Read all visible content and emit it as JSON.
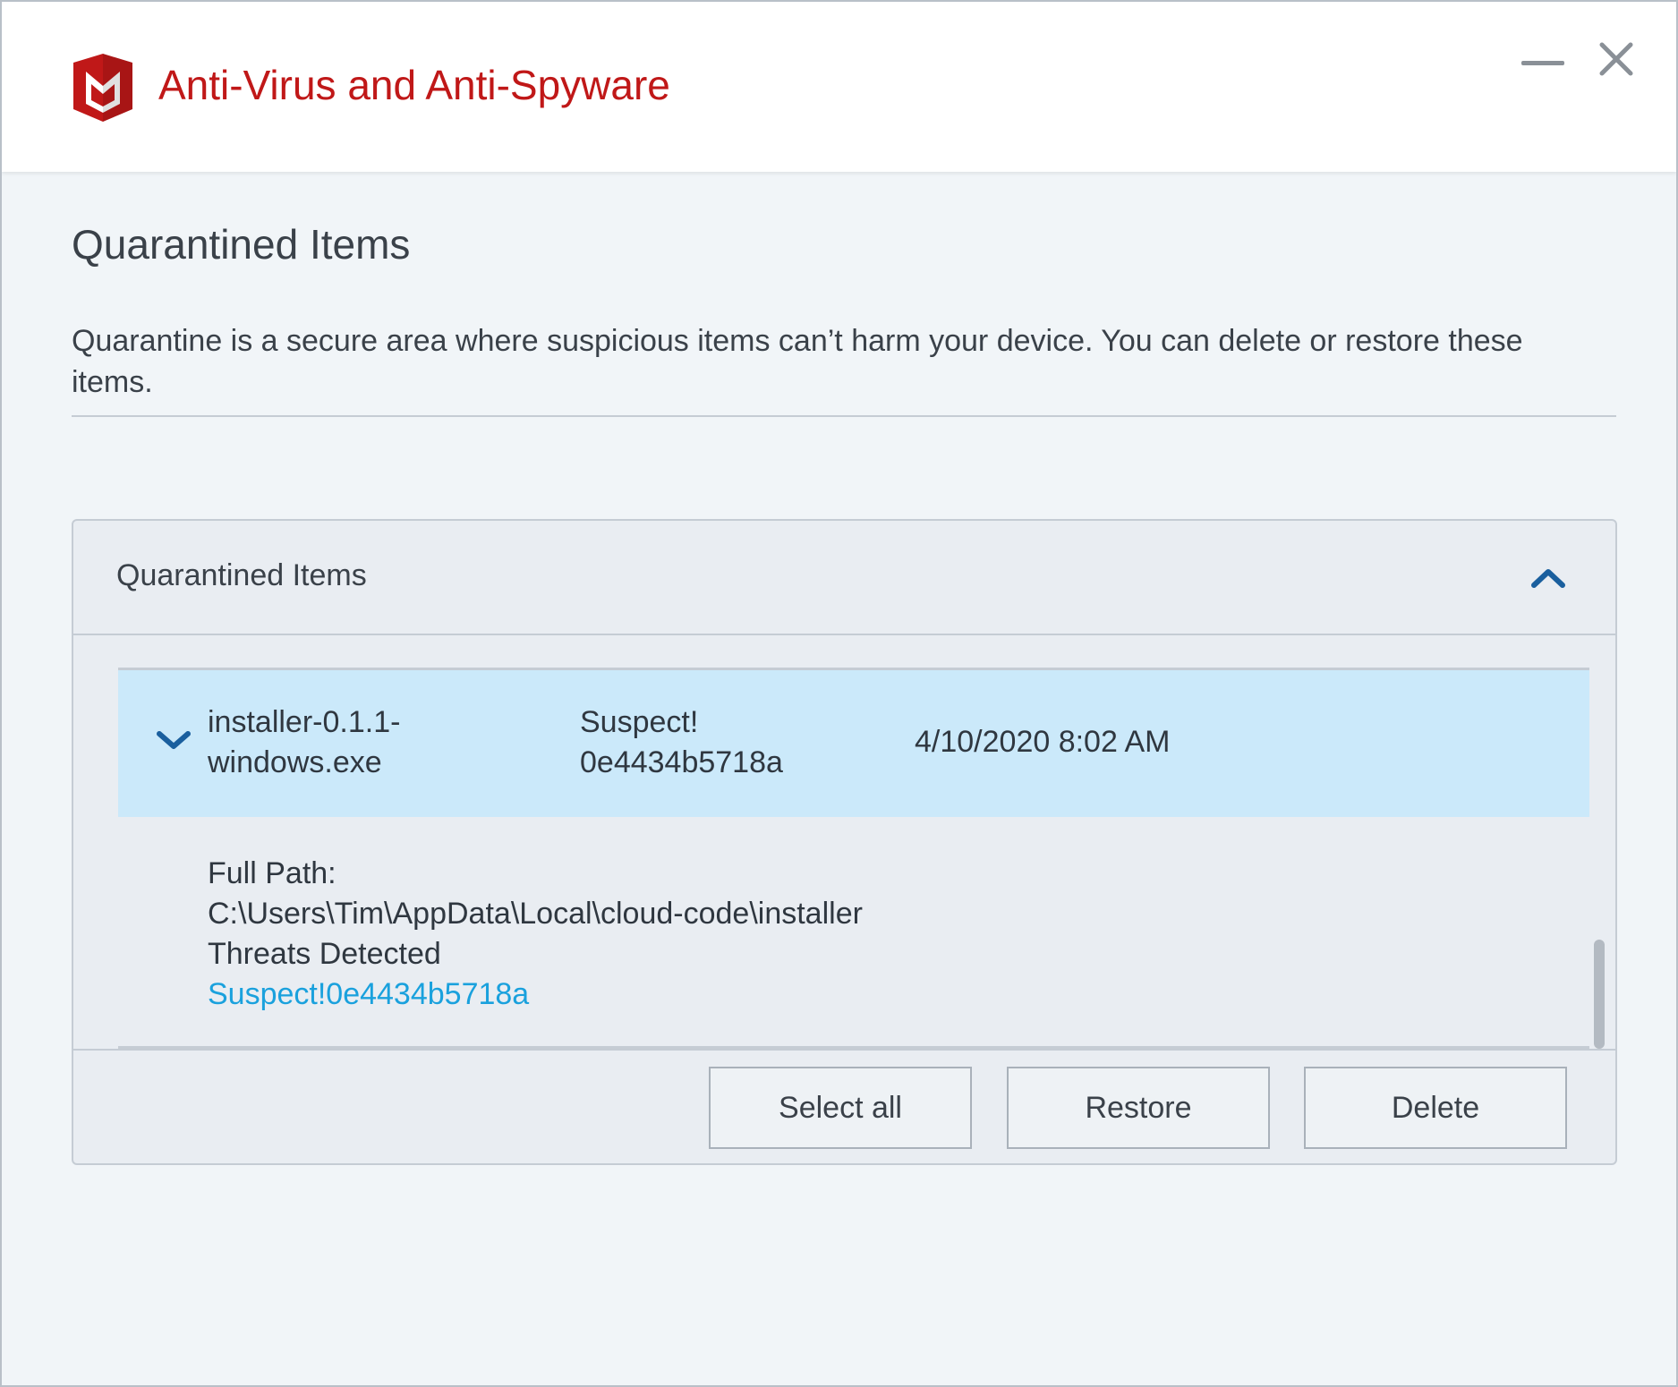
{
  "window": {
    "title": "Anti-Virus and Anti-Spyware",
    "accent_color": "#c01818",
    "controls": [
      "minimize-icon",
      "close-icon"
    ]
  },
  "main": {
    "page_title": "Quarantined Items",
    "description": "Quarantine is a secure area where suspicious items can’t harm your device. You can delete or restore these items."
  },
  "panel": {
    "title": "Quarantined Items",
    "collapse_icon": "chevron-up-icon",
    "items": [
      {
        "name_line1": "installer-0.1.1-",
        "name_line2": "windows.exe",
        "threat_line1": "Suspect!",
        "threat_line2": "0e4434b5718a",
        "date": "4/10/2020 8:02 AM",
        "expanded": true,
        "details": {
          "full_path_label": "Full Path:",
          "full_path": "C:\\Users\\Tim\\AppData\\Local\\cloud-code\\installer",
          "threats_label": "Threats Detected",
          "threat_link": "Suspect!0e4434b5718a"
        }
      }
    ],
    "buttons": {
      "select_all": "Select all",
      "restore": "Restore",
      "delete": "Delete"
    }
  },
  "colors": {
    "row_selected": "#cbe9fa",
    "link": "#1aa1dd",
    "chevron": "#1a5f9e"
  }
}
